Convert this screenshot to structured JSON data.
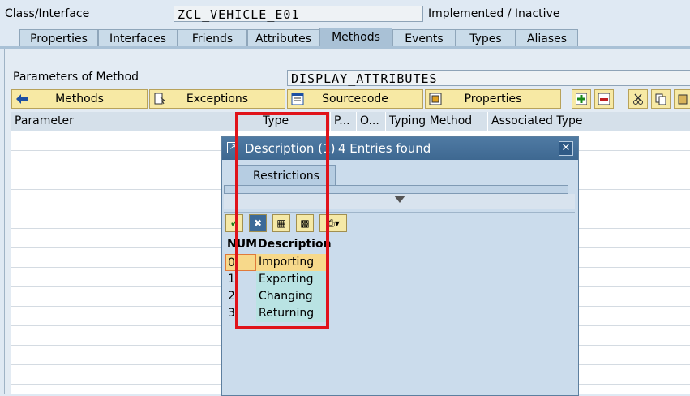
{
  "header": {
    "class_label": "Class/Interface",
    "class_value": "ZCL_VEHICLE_E01",
    "status": "Implemented / Inactive"
  },
  "tabs": [
    {
      "label": "Properties"
    },
    {
      "label": "Interfaces"
    },
    {
      "label": "Friends"
    },
    {
      "label": "Attributes"
    },
    {
      "label": "Methods",
      "active": true
    },
    {
      "label": "Events"
    },
    {
      "label": "Types"
    },
    {
      "label": "Aliases"
    }
  ],
  "method": {
    "label": "Parameters of Method",
    "value": "DISPLAY_ATTRIBUTES"
  },
  "toolbar": {
    "methods_label": "Methods",
    "exceptions_label": "Exceptions",
    "sourcecode_label": "Sourcecode",
    "properties_label": "Properties"
  },
  "table": {
    "headers": [
      "Parameter",
      "Type",
      "P...",
      "O...",
      "Typing Method",
      "Associated Type"
    ]
  },
  "dialog": {
    "title": "Description (1)",
    "entries_found": "4 Entries found",
    "tab_label": "Restrictions",
    "col_num": "NUM",
    "col_desc": "Description",
    "rows": [
      {
        "num": "0",
        "desc": "Importing"
      },
      {
        "num": "1",
        "desc": "Exporting"
      },
      {
        "num": "2",
        "desc": "Changing"
      },
      {
        "num": "3",
        "desc": "Returning"
      }
    ]
  },
  "colors": {
    "highlight_box": "#e0131a",
    "selected_row": "#f7d98b",
    "list_cell": "#b9e3e3"
  }
}
